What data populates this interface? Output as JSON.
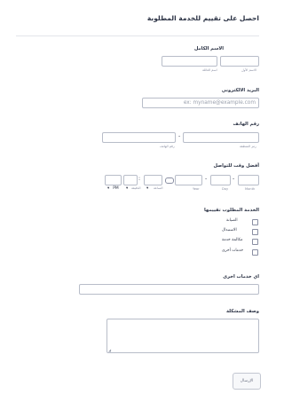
{
  "form": {
    "title": "احصل على تقييم للخدمة المطلوبة",
    "full_name": {
      "label": "الاسم الكامل",
      "first_sub": "الاسم الأول",
      "last_sub": "اسم العائلة",
      "first_value": "",
      "last_value": ""
    },
    "email": {
      "label": "البريد الالكتروني",
      "placeholder": "ex: myname@example.com"
    },
    "phone": {
      "label": "رقم الهاتف",
      "area_sub": "رمز المنطقة",
      "number_sub": "رقم الهاتف"
    },
    "contact_time": {
      "label": "أفضل وقت للتواصل",
      "month_sub": "Month",
      "day_sub": "Day",
      "year_sub": "Year",
      "hour_sub": "الساعة",
      "minute_sub": "الدقيقة",
      "ampm": "PM",
      "separator": "-",
      "colon": ":"
    },
    "service": {
      "label": "الخدمة المطلوب تقييمها",
      "options": [
        "الصيانة",
        "الاستبدال",
        "مكالمة خدمة",
        "خدمات أخرى"
      ]
    },
    "other_services": {
      "label": "اي خدمات اخرى"
    },
    "problem": {
      "label": "وصف المشكلة"
    },
    "submit_label": "الإرسال"
  },
  "colors": {
    "border": "#b8bdc9",
    "text": "#2c3345",
    "muted": "#8a8fa3"
  }
}
